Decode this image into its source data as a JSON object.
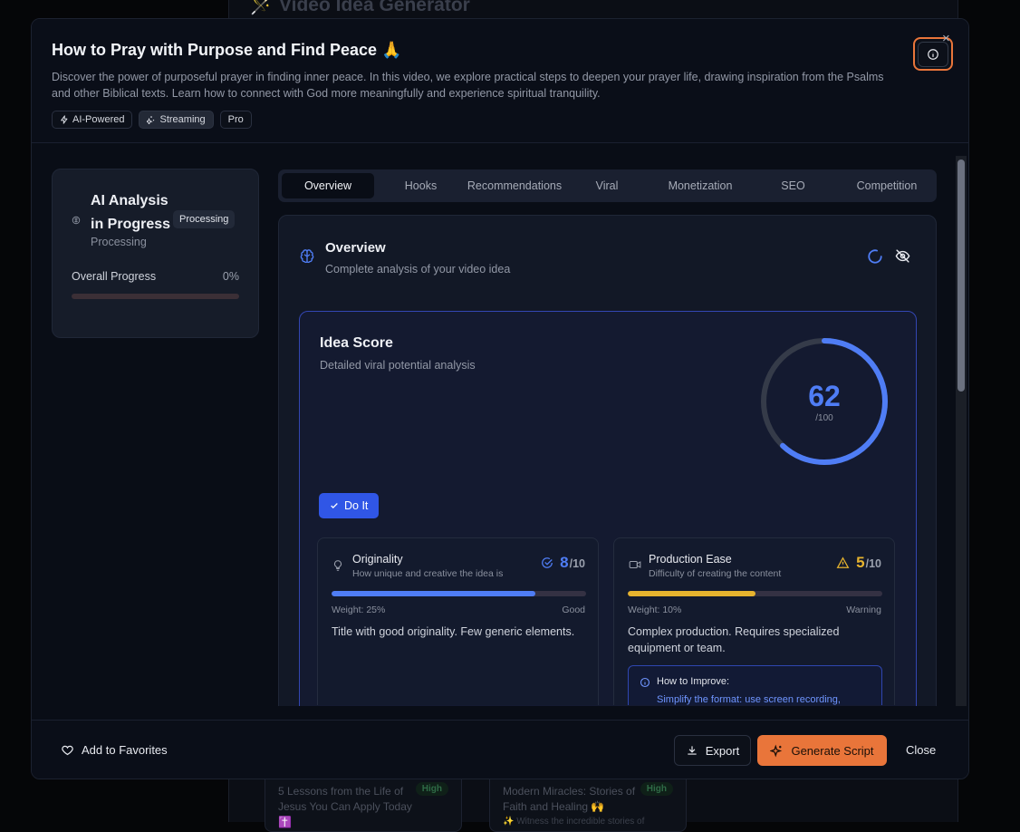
{
  "background": {
    "title": "🪄 Video Idea Generator",
    "cards": [
      {
        "title": "5 Lessons from the Life of Jesus You Can Apply Today ✝️",
        "badge": "High",
        "snippet": ""
      },
      {
        "title": "Modern Miracles: Stories of Faith and Healing 🙌",
        "badge": "High",
        "snippet": "✨ Witness the incredible stories of"
      }
    ]
  },
  "modal": {
    "title": "How to Pray with Purpose and Find Peace 🙏",
    "description": "Discover the power of purposeful prayer in finding inner peace. In this video, we explore practical steps to deepen your prayer life, drawing inspiration from the Psalms and other Biblical texts. Learn how to connect with God more meaningfully and experience spiritual tranquility.",
    "tags": [
      "AI-Powered",
      "Streaming",
      "Pro"
    ],
    "close_symbol": "×"
  },
  "ai_card": {
    "title": "AI Analysis in Progress",
    "badge": "Processing",
    "subtitle": "Processing",
    "progress_label": "Overall Progress",
    "progress_text": "0%",
    "progress_value": 0
  },
  "tabs": [
    "Overview",
    "Hooks",
    "Recommendations",
    "Viral",
    "Monetization",
    "SEO",
    "Competition"
  ],
  "overview": {
    "title": "Overview",
    "subtitle": "Complete analysis of your video idea"
  },
  "idea_score": {
    "title": "Idea Score",
    "subtitle": "Detailed viral potential analysis",
    "score": 62,
    "max_label": "/100",
    "verdict": "Do It"
  },
  "metrics": [
    {
      "title": "Originality",
      "subtitle": "How unique and creative the idea is",
      "score": "8",
      "max": "/10",
      "fraction": 0.8,
      "weight": "Weight: 25%",
      "level": "Good",
      "description": "Title with good originality. Few generic elements.",
      "color": "#4f7df5"
    },
    {
      "title": "Production Ease",
      "subtitle": "Difficulty of creating the content",
      "score": "5",
      "max": "/10",
      "fraction": 0.5,
      "weight": "Weight: 10%",
      "level": "Warning",
      "description": "Complex production. Requires specialized equipment or team.",
      "color": "#e6b32e",
      "improve_title": "How to Improve:",
      "improve_text": "Simplify the format: use screen recording,"
    }
  ],
  "footer": {
    "favorites": "Add to Favorites",
    "export": "Export",
    "generate": "Generate Script",
    "close": "Close"
  },
  "colors": {
    "accent": "#e9753a",
    "primary": "#3056e6",
    "score_blue": "#4f7df5",
    "warning": "#e6b32e"
  }
}
